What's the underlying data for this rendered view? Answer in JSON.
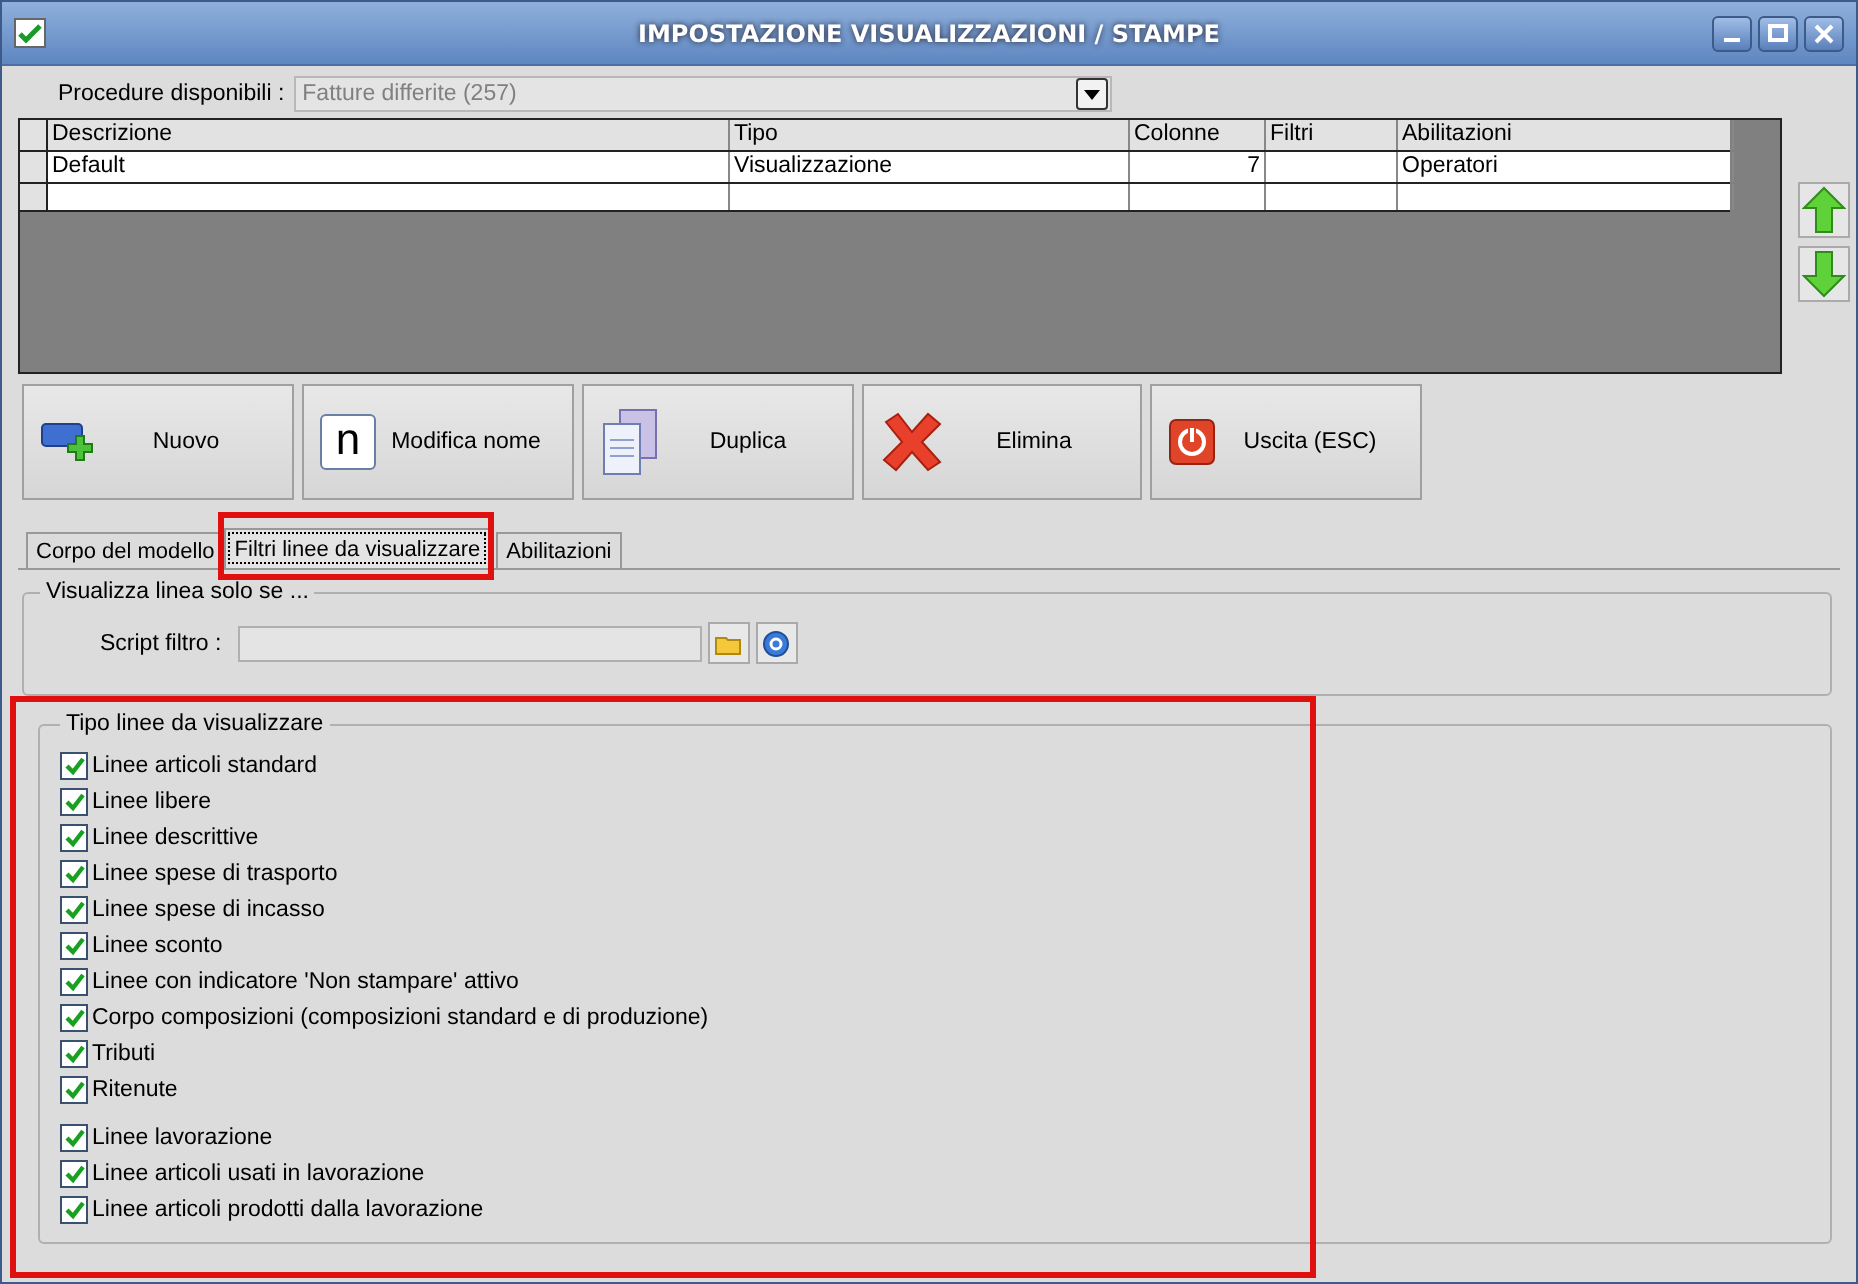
{
  "window": {
    "title": "IMPOSTAZIONE VISUALIZZAZIONI / STAMPE",
    "checked": true
  },
  "procedure": {
    "label": "Procedure disponibili :",
    "value": "Fatture differite (257)"
  },
  "table": {
    "columns": [
      "Descrizione",
      "Tipo",
      "Colonne",
      "Filtri",
      "Abilitazioni"
    ],
    "rows": [
      [
        "Default",
        "Visualizzazione",
        "7",
        "",
        "Operatori"
      ]
    ]
  },
  "buttons": [
    {
      "kind": "new",
      "label": "Nuovo"
    },
    {
      "kind": "rename",
      "label": "Modifica nome",
      "icon_text": "n"
    },
    {
      "kind": "duplicate",
      "label": "Duplica"
    },
    {
      "kind": "delete",
      "label": "Elimina"
    },
    {
      "kind": "exit",
      "label": "Uscita (ESC)"
    }
  ],
  "tabs": [
    {
      "label": "Corpo del modello",
      "selected": false
    },
    {
      "label": "Filtri linee da visualizzare",
      "selected": true
    },
    {
      "label": "Abilitazioni",
      "selected": false
    }
  ],
  "filter_group": {
    "title": "Visualizza linea solo se ...",
    "script_label": "Script filtro :"
  },
  "lines_group": {
    "title": "Tipo linee da visualizzare",
    "groups": [
      [
        {
          "label": "Linee articoli standard",
          "checked": true
        },
        {
          "label": "Linee libere",
          "checked": true
        },
        {
          "label": "Linee descrittive",
          "checked": true
        },
        {
          "label": "Linee spese di trasporto",
          "checked": true
        },
        {
          "label": "Linee spese di incasso",
          "checked": true
        },
        {
          "label": "Linee sconto",
          "checked": true
        },
        {
          "label": "Linee con indicatore 'Non stampare' attivo",
          "checked": true
        },
        {
          "label": "Corpo composizioni (composizioni standard e di produzione)",
          "checked": true
        },
        {
          "label": "Tributi",
          "checked": true
        },
        {
          "label": "Ritenute",
          "checked": true
        }
      ],
      [
        {
          "label": "Linee lavorazione",
          "checked": true
        },
        {
          "label": "Linee articoli usati in lavorazione",
          "checked": true
        },
        {
          "label": "Linee articoli prodotti dalla lavorazione",
          "checked": true
        }
      ]
    ]
  }
}
